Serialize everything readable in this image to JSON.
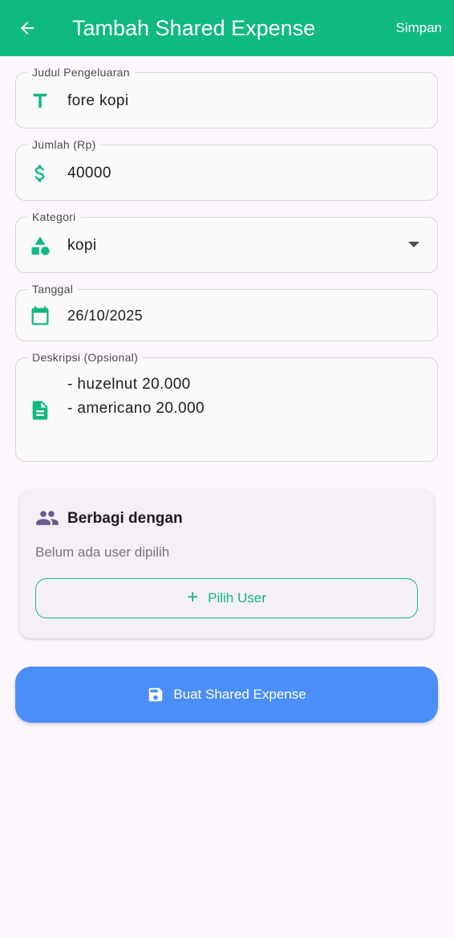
{
  "appbar": {
    "title": "Tambah Shared Expense",
    "save_label": "Simpan",
    "back_icon": "arrow-back-icon"
  },
  "form": {
    "title_field": {
      "label": "Judul Pengeluaran",
      "value": "fore kopi",
      "icon": "text-icon"
    },
    "amount_field": {
      "label": "Jumlah (Rp)",
      "value": "40000",
      "icon": "dollar-icon"
    },
    "category_field": {
      "label": "Kategori",
      "value": "kopi",
      "icon": "category-shapes-icon"
    },
    "date_field": {
      "label": "Tanggal",
      "value": "26/10/2025",
      "icon": "calendar-icon"
    },
    "description_field": {
      "label": "Deskripsi (Opsional)",
      "value": "- huzelnut 20.000\n- americano 20.000",
      "icon": "document-icon"
    }
  },
  "share": {
    "title": "Berbagi dengan",
    "empty_text": "Belum ada user dipilih",
    "pick_label": "Pilih User",
    "icon": "group-icon"
  },
  "submit": {
    "label": "Buat Shared Expense",
    "icon": "save-icon"
  },
  "colors": {
    "primary": "#10b981",
    "submit_button": "#4b8ef7",
    "background": "#fdf7fd",
    "group_icon": "#6b5b8c"
  }
}
